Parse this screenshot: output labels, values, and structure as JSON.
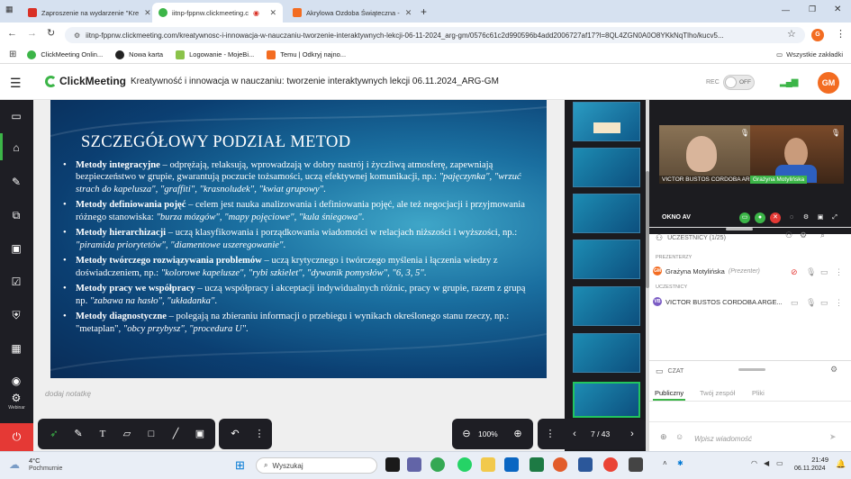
{
  "browser": {
    "tabs": [
      {
        "label": "Zaproszenie na wydarzenie \"Kre",
        "color": "#d93025"
      },
      {
        "label": "iitnp-fppnw.clickmeeting.c",
        "color": "#3cb548"
      },
      {
        "label": "Akrylowa Ozdoba Świąteczna -",
        "color": "#f36c21"
      }
    ],
    "new_tab": "+",
    "url": "iitnp-fppnw.clickmeeting.com/kreatywnosc-i-innowacja-w-nauczaniu-tworzenie-interaktywnych-lekcji-06-11-2024_arg-gm/0576c61c2d990596b4add2006727af17?l=8QL4ZGN0A0O8YKkNqTlho/kucv5...",
    "profile_initial": "G",
    "bookmarks": [
      "ClickMeeting Onlin...",
      "Nowa karta",
      "Logowanie - MojeBi...",
      "Temu | Odkryj najno..."
    ],
    "all_bookmarks": "Wszystkie zakładki"
  },
  "header": {
    "logo": "ClickMeeting",
    "event_title": "Kreatywność i innowacja w nauczaniu: tworzenie interaktywnych lekcji 06.11.2024_ARG-GM",
    "rec_label": "REC",
    "rec_toggle": "OFF",
    "avatar": "GM",
    "avatar_color": "#f36c21"
  },
  "slide": {
    "title": "SZCZEGÓŁOWY PODZIAŁ METOD",
    "methods": [
      {
        "name": "Metody integracyjne",
        "text": " – odprężają, relaksują, wprowadzają w dobry nastrój i życzliwą atmosferę, zapewniają bezpieczeństwo w grupie, gwarantują poczucie tożsamości, uczą efektywnej komunikacji, np.: ",
        "examples": "\"pajęczynka\", \"wrzuć strach do kapelusza\", \"graffiti\", \"krasnoludek\", \"kwiat grupowy\"",
        "end": "."
      },
      {
        "name": "Metody definiowania pojęć",
        "text": " – celem jest nauka analizowania i definiowania pojęć, ale też negocjacji i przyjmowania różnego stanowiska: ",
        "examples": "\"burza mózgów\", \"mapy pojęciowe\", \"kula śniegowa\"",
        "end": "."
      },
      {
        "name": "Metody hierarchizacji",
        "text": " – uczą klasyfikowania i porządkowania wiadomości w relacjach niższości i wyższości, np.: ",
        "examples": "\"piramida priorytetów\", \"diamentowe uszeregowanie\"",
        "end": "."
      },
      {
        "name": "Metody twórczego rozwiązywania problemów",
        "text": " – uczą krytycznego i twórczego myślenia i łączenia wiedzy z doświadczeniem, np.: ",
        "examples": "\"kolorowe kapelusze\", \"rybi szkielet\", \"dywanik pomysłów\", \"6, 3, 5\"",
        "end": "."
      },
      {
        "name": "Metody pracy we współpracy",
        "text": " – uczą współpracy i akceptacji indywidualnych różnic, pracy w grupie, razem z grupą np. ",
        "examples": "\"zabawa na hasło\", \"układanka\"",
        "end": "."
      },
      {
        "name": "Metody diagnostyczne",
        "text": " – polegają na zbieraniu informacji o przebiegu i wynikach określonego stanu rzeczy, np.: \"metaplan\", ",
        "examples": "\"obcy przybysz\", \"procedura U\"",
        "end": "."
      }
    ],
    "note_placeholder": "dodaj notatkę"
  },
  "rail": {
    "webinar_label": "Webinar"
  },
  "toolbar": {
    "zoom": "100%",
    "page": "7 / 43"
  },
  "participants": {
    "videos": [
      {
        "name": "VICTOR BUSTOS CORDOBA ARG..."
      },
      {
        "name": "Grażyna Motylińska"
      }
    ],
    "okno_label": "OKNO AV",
    "section_label": "UCZESTNICY (1/25)",
    "presenters_label": "PREZENTERZY",
    "attendees_label": "UCZESTNICY",
    "presenter": {
      "initials": "GM",
      "name": "Grażyna Motylińska",
      "role": "(Prezenter)",
      "color": "#f36c21"
    },
    "attendee": {
      "initials": "VB",
      "name": "VICTOR BUSTOS CORDOBA ARGE...",
      "color": "#7b5cc4"
    }
  },
  "chat": {
    "label": "CZAT",
    "tabs": [
      "Publiczny",
      "Twój zespół",
      "Pliki"
    ],
    "placeholder": "Wpisz wiadomość"
  },
  "taskbar": {
    "weather_temp": "4°C",
    "weather_desc": "Pochmurnie",
    "search": "Wyszukaj",
    "time": "21:49",
    "date": "06.11.2024"
  }
}
